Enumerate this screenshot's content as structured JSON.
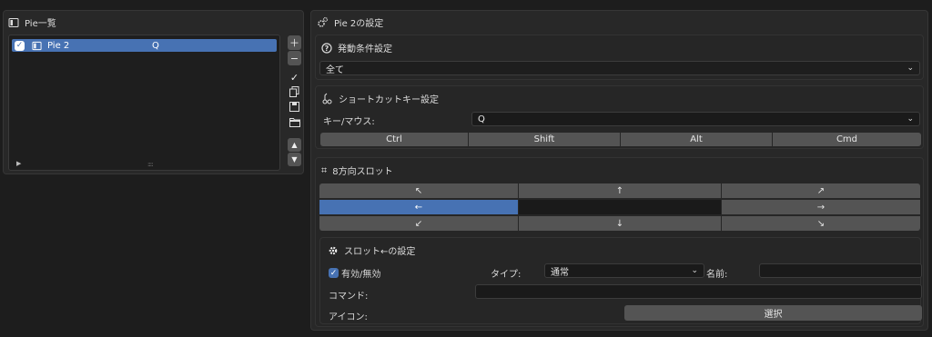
{
  "pie_list": {
    "title": "Pie一覧",
    "items": [
      {
        "name": "Pie 2",
        "key": "Q",
        "checked": true
      }
    ]
  },
  "settings": {
    "title": "Pie 2の設定",
    "trigger": {
      "title": "発動条件設定",
      "value": "全て"
    },
    "shortcut": {
      "title": "ショートカットキー設定",
      "key_label": "キー/マウス:",
      "key_value": "Q",
      "modifiers": [
        "Ctrl",
        "Shift",
        "Alt",
        "Cmd"
      ]
    },
    "slots": {
      "title": "8方向スロット",
      "arrows": [
        "↖",
        "↑",
        "↗",
        "←",
        "",
        "→",
        "↙",
        "↓",
        "↘"
      ]
    },
    "slot_settings": {
      "title": "スロット←の設定",
      "enabled_label": "有効/無効",
      "type_label": "タイプ:",
      "type_value": "通常",
      "name_label": "名前:",
      "name_value": "",
      "command_label": "コマンド:",
      "command_value": "",
      "icon_label": "アイコン:",
      "select_label": "選択"
    }
  },
  "colors": {
    "accent": "#4772b3",
    "panel": "#282828",
    "button": "#545454"
  }
}
